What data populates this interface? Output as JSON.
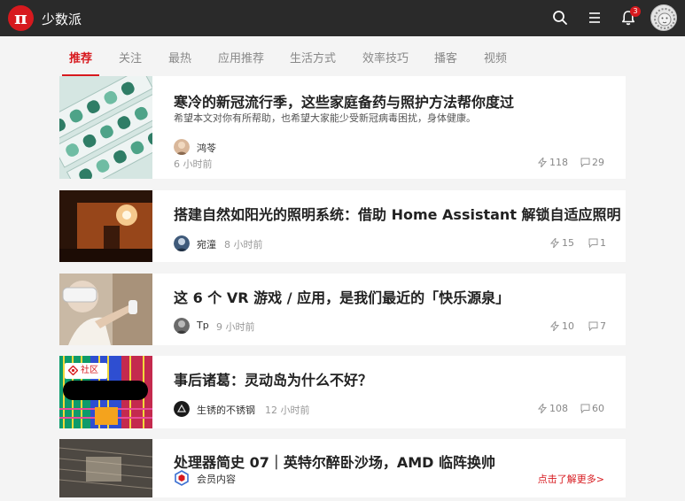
{
  "header": {
    "logo_glyph": "π",
    "brand": "少数派",
    "notification_count": "3"
  },
  "tabs": [
    {
      "label": "推荐",
      "active": true
    },
    {
      "label": "关注"
    },
    {
      "label": "最热"
    },
    {
      "label": "应用推荐"
    },
    {
      "label": "生活方式"
    },
    {
      "label": "效率技巧"
    },
    {
      "label": "播客"
    },
    {
      "label": "视频"
    }
  ],
  "articles": [
    {
      "title": "寒冷的新冠流行季，这些家庭备药与照护方法帮你度过",
      "excerpt": "希望本文对你有所帮助，也希望大家能少受新冠病毒困扰，身体健康。",
      "author": "鸿苓",
      "time": "6 小时前",
      "likes": "118",
      "comments": "29",
      "thumb": "pill-blister-photo"
    },
    {
      "title": "搭建自然如阳光的照明系统：借助 Home Assistant 解锁自适应照明",
      "author": "宛潼",
      "time": "8 小时前",
      "likes": "15",
      "comments": "1",
      "thumb": "sunlit-wall-photo"
    },
    {
      "title": "这 6 个 VR 游戏 / 应用，是我们最近的「快乐源泉」",
      "author": "Tp",
      "time": "9 小时前",
      "likes": "10",
      "comments": "7",
      "thumb": "vr-headset-photo"
    },
    {
      "title": "事后诸葛：灵动岛为什么不好？",
      "author": "生锈的不锈钢",
      "time": "12 小时前",
      "likes": "108",
      "comments": "60",
      "thumb": "colorful-circuit-illustration",
      "tag": "社区"
    },
    {
      "title": "处理器简史 07｜英特尔醉卧沙场，AMD 临阵换帅",
      "member_label": "会员内容",
      "more_link": "点击了解更多>",
      "thumb": "cpu-chip-photo"
    }
  ],
  "colors": {
    "brand_red": "#d7191e",
    "header_bg": "#2a2a2a",
    "page_bg": "#f4f4f4"
  }
}
